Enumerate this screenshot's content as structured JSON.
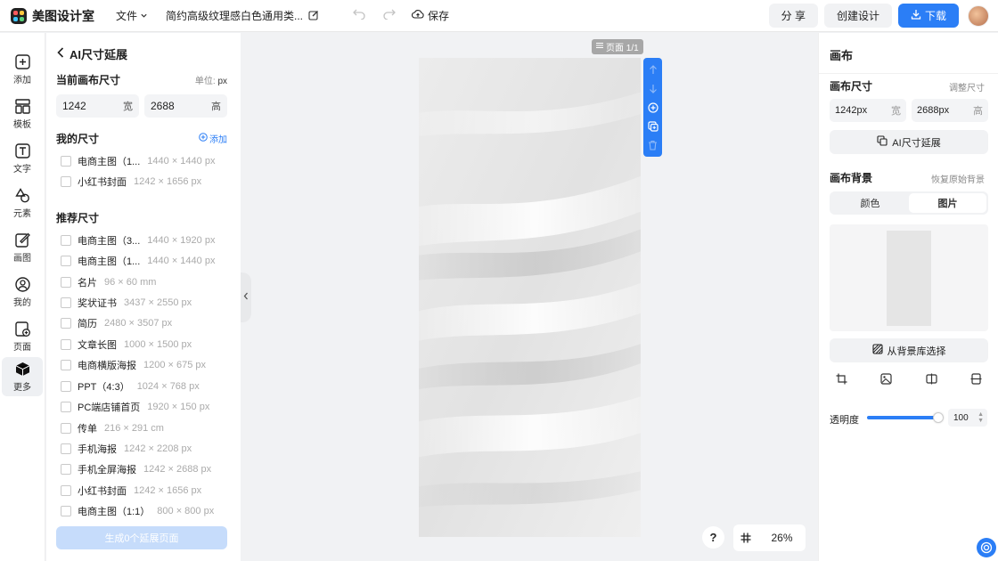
{
  "header": {
    "app_name": "美图设计室",
    "file_menu": "文件",
    "doc_title": "简约高级纹理感白色通用类...",
    "save": "保存",
    "share": "分 享",
    "create": "创建设计",
    "download": "下载"
  },
  "rail": {
    "items": [
      {
        "label": "添加",
        "icon": "plus-square-icon"
      },
      {
        "label": "模板",
        "icon": "template-icon"
      },
      {
        "label": "文字",
        "icon": "text-icon"
      },
      {
        "label": "元素",
        "icon": "shapes-icon"
      },
      {
        "label": "画图",
        "icon": "draw-icon"
      },
      {
        "label": "我的",
        "icon": "user-icon"
      },
      {
        "label": "页面",
        "icon": "page-icon"
      },
      {
        "label": "更多",
        "icon": "cube-icon"
      }
    ],
    "active": "更多"
  },
  "left_panel": {
    "title": "AI尺寸延展",
    "current_size_title": "当前画布尺寸",
    "unit_label": "单位:",
    "unit_value": "px",
    "width_value": "1242",
    "width_suffix": "宽",
    "height_value": "2688",
    "height_suffix": "高",
    "my_sizes_title": "我的尺寸",
    "add_label": "添加",
    "my_sizes": [
      {
        "name": "电商主图（1...",
        "dim": "1440 × 1440 px"
      },
      {
        "name": "小红书封面",
        "dim": "1242 × 1656 px"
      }
    ],
    "recommended_title": "推荐尺寸",
    "recommended": [
      {
        "name": "电商主图（3...",
        "dim": "1440 × 1920 px"
      },
      {
        "name": "电商主图（1...",
        "dim": "1440 × 1440 px"
      },
      {
        "name": "名片",
        "dim": "96 × 60 mm"
      },
      {
        "name": "奖状证书",
        "dim": "3437 × 2550 px"
      },
      {
        "name": "简历",
        "dim": "2480 × 3507 px"
      },
      {
        "name": "文章长图",
        "dim": "1000 × 1500 px"
      },
      {
        "name": "电商横版海报",
        "dim": "1200 × 675 px"
      },
      {
        "name": "PPT（4:3）",
        "dim": "1024 × 768 px"
      },
      {
        "name": "PC端店铺首页",
        "dim": "1920 × 150 px"
      },
      {
        "name": "传单",
        "dim": "216 × 291 cm"
      },
      {
        "name": "手机海报",
        "dim": "1242 × 2208 px"
      },
      {
        "name": "手机全屏海报",
        "dim": "1242 × 2688 px"
      },
      {
        "name": "小红书封面",
        "dim": "1242 × 1656 px"
      },
      {
        "name": "电商主图（1:1）",
        "dim": "800 × 800 px"
      }
    ],
    "generate_button": "生成0个延展页面"
  },
  "canvas": {
    "page_label": "页面 1/1",
    "zoom": "26%",
    "help": "?"
  },
  "right_panel": {
    "title": "画布",
    "canvas_size_label": "画布尺寸",
    "adjust_size": "调整尺寸",
    "width_value": "1242px",
    "width_suffix": "宽",
    "height_value": "2688px",
    "height_suffix": "高",
    "ai_expand_button": "AI尺寸延展",
    "bg_label": "画布背景",
    "restore_bg": "恢复原始背景",
    "tab_color": "颜色",
    "tab_image": "图片",
    "from_library_button": "从背景库选择",
    "opacity_label": "透明度",
    "opacity_value": "100"
  },
  "colors": {
    "accent": "#2b7ef6",
    "generate_disabled": "#c6dcfb"
  }
}
